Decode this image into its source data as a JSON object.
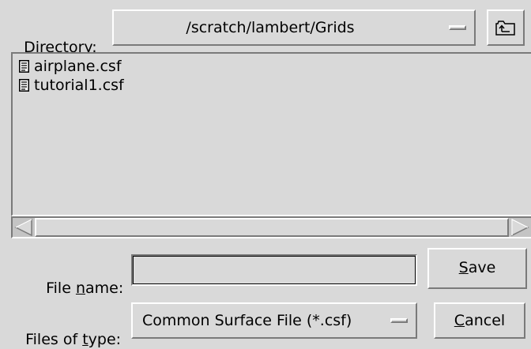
{
  "directory": {
    "label_prefix": "",
    "label_mnemonic": "D",
    "label_rest": "irectory:",
    "path": "/scratch/lambert/Grids"
  },
  "file_list": {
    "items": [
      {
        "name": "airplane.csf",
        "icon": "document-icon"
      },
      {
        "name": "tutorial1.csf",
        "icon": "document-icon"
      }
    ]
  },
  "file_name": {
    "label_prefix": "File ",
    "label_mnemonic": "n",
    "label_rest": "ame:",
    "value": ""
  },
  "files_of_type": {
    "label_prefix": "Files of ",
    "label_mnemonic": "t",
    "label_rest": "ype:",
    "selected": "Common Surface File (*.csf)"
  },
  "buttons": {
    "save_mnemonic": "S",
    "save_rest": "ave",
    "cancel_mnemonic": "C",
    "cancel_rest": "ancel"
  },
  "colors": {
    "background": "#d9d9d9",
    "highlight": "#ffffff",
    "shadow": "#7a7a7a"
  }
}
